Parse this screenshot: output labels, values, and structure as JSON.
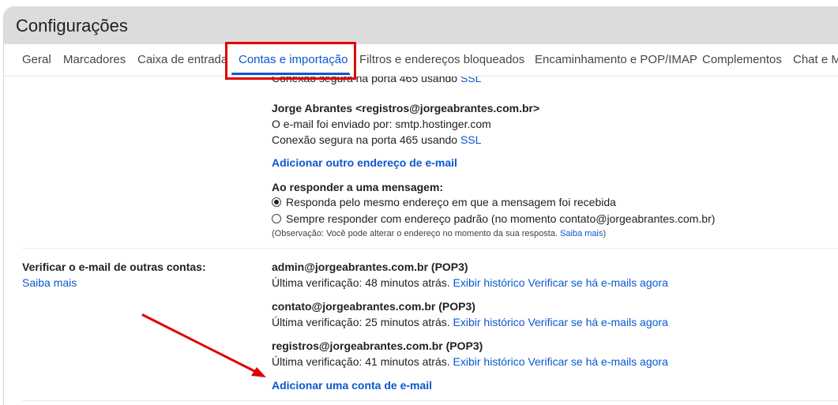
{
  "window": {
    "title": "Configurações"
  },
  "tabs": [
    {
      "label": "Geral"
    },
    {
      "label": "Marcadores"
    },
    {
      "label": "Caixa de entrada"
    },
    {
      "label": "Contas e importação"
    },
    {
      "label": "Filtros e endereços bloqueados"
    },
    {
      "label": "Encaminhamento e POP/IMAP"
    },
    {
      "label": "Complementos"
    },
    {
      "label": "Chat e M"
    }
  ],
  "active_tab": "Contas e importação",
  "send_as": {
    "prev_connection": {
      "text": "Conexão segura na porta 465 usando ",
      "ssl": "SSL"
    },
    "account": {
      "name": "Jorge Abrantes <registros@jorgeabrantes.com.br>",
      "sent_via": "O e-mail foi enviado por: smtp.hostinger.com",
      "connection": "Conexão segura na porta 465 usando ",
      "ssl": "SSL"
    },
    "add_link": "Adicionar outro endereço de e-mail",
    "reply_heading": "Ao responder a uma mensagem:",
    "reply_options": [
      {
        "label": "Responda pelo mesmo endereço em que a mensagem foi recebida",
        "checked": true
      },
      {
        "label": "Sempre responder com endereço padrão (no momento contato@jorgeabrantes.com.br)",
        "checked": false
      }
    ],
    "note_prefix": "(Observação: Você pode alterar o endereço no momento da sua resposta. ",
    "note_link": "Saiba mais",
    "note_suffix": ")"
  },
  "check_mail": {
    "label": "Verificar o e-mail de outras contas:",
    "learn_more": "Saiba mais",
    "accounts": [
      {
        "address": "admin@jorgeabrantes.com.br (POP3)",
        "last_check": "Última verificação: 48 minutos atrás.",
        "history": "Exibir histórico",
        "check_now": "Verificar se há e-mails agora"
      },
      {
        "address": "contato@jorgeabrantes.com.br (POP3)",
        "last_check": "Última verificação: 25 minutos atrás.",
        "history": "Exibir histórico",
        "check_now": "Verificar se há e-mails agora"
      },
      {
        "address": "registros@jorgeabrantes.com.br (POP3)",
        "last_check": "Última verificação: 41 minutos atrás.",
        "history": "Exibir histórico",
        "check_now": "Verificar se há e-mails agora"
      }
    ],
    "add_account": "Adicionar uma conta de e-mail"
  },
  "colors": {
    "accent": "#0b57d0",
    "annotation": "#e00000",
    "title_bar": "#dcdcdc"
  }
}
